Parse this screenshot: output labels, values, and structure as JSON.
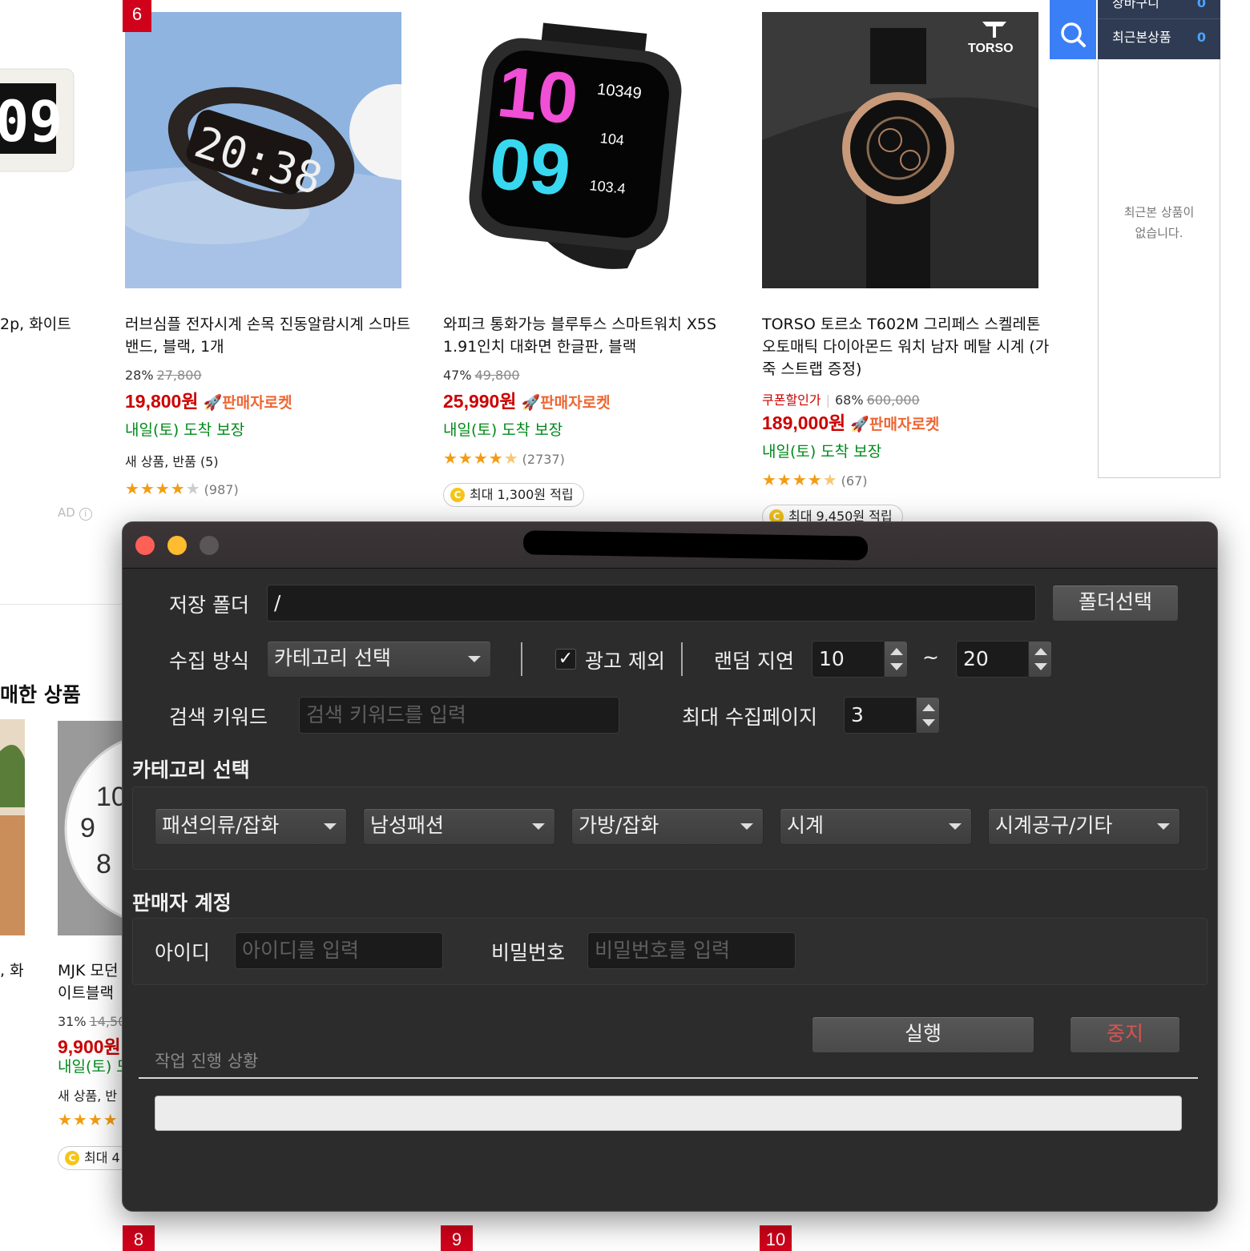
{
  "products": [
    {
      "rank": "6",
      "title": "러브심플 전자시계 손목 진동알람시계 스마트 밴드, 블랙, 1개",
      "discount": "28%",
      "original_price": "27,800",
      "price": "19,800원",
      "rocket_label": "판매자로켓",
      "delivery": "내일(토) 도착 보장",
      "extra_info": "새 상품, 반품 (5)",
      "rating": 4.0,
      "review_count": "(987)"
    },
    {
      "title": "와피크 통화가능 블루투스 스마트워치 X5S 1.91인치 대화면 한글판, 블랙",
      "discount": "47%",
      "original_price": "49,800",
      "price": "25,990원",
      "rocket_label": "판매자로켓",
      "delivery": "내일(토) 도착 보장",
      "rating": 4.5,
      "review_count": "(2737)",
      "cashback": "최대 1,300원 적립"
    },
    {
      "title": "TORSO 토르소 T602M 그리페스 스켈레톤 오토매틱 다이아몬드 워치 남자 메탈 시계 (가죽 스트랩 증정)",
      "coupon_label": "쿠폰할인가",
      "discount": "68%",
      "original_price": "600,000",
      "price": "189,000원",
      "rocket_label": "판매자로켓",
      "delivery": "내일(토) 도착 보장",
      "rating": 4.5,
      "review_count": "(67)",
      "cashback": "최대 9,450원 적립",
      "brand_logo": "TORSO"
    }
  ],
  "left_partial": {
    "title_fragment": "2p, 화이트",
    "ad_label": "AD",
    "section_title": "매한 상품",
    "second_title_fragment": ", 화"
  },
  "left_product_2": {
    "title": "MJK 모던\n이트블랙",
    "discount": "31%",
    "original_price": "14,50",
    "price": "9,900원",
    "delivery": "내일(토) 도",
    "extra_info": "새 상품, 반",
    "cashback": "최대 4"
  },
  "clock_face_numbers": [
    "10",
    "9",
    "8"
  ],
  "bottom_ranks": [
    "8",
    "9",
    "10"
  ],
  "sidebar": {
    "cart_label": "장바구니",
    "cart_count": "0",
    "recent_label": "최근본상품",
    "recent_count": "0",
    "empty_message": "최근본 상품이\n없습니다."
  },
  "icons": {
    "search": "search-icon",
    "info": "info-icon",
    "coin": "coin-icon",
    "rocket": "rocket-icon"
  },
  "dialog": {
    "title_redacted": "redacted",
    "save_folder_label": "저장 폴더",
    "save_folder_value": "/",
    "folder_select_button": "폴더선택",
    "collect_method_label": "수집 방식",
    "collect_method_value": "카테고리 선택",
    "exclude_ads_label": "광고 제외",
    "exclude_ads_checked": true,
    "random_delay_label": "랜덤 지연",
    "delay_min": "10",
    "delay_separator": "~",
    "delay_max": "20",
    "keyword_label": "검색 키워드",
    "keyword_placeholder": "검색 키워드를 입력",
    "max_pages_label": "최대 수집페이지",
    "max_pages_value": "3",
    "category_section_label": "카테고리 선택",
    "categories": [
      "패션의류/잡화",
      "남성패션",
      "가방/잡화",
      "시계",
      "시계공구/기타"
    ],
    "seller_section_label": "판매자 계정",
    "id_label": "아이디",
    "id_placeholder": "아이디를 입력",
    "password_label": "비밀번호",
    "password_placeholder": "비밀번호를 입력",
    "run_button": "실행",
    "stop_button": "중지",
    "progress_label": "작업 진행 상황",
    "progress": 0
  },
  "colors": {
    "price_red": "#cc0000",
    "delivery_green": "#00891a",
    "star_orange": "#f39c12",
    "search_blue": "#3a7ff6",
    "sidebar_navy": "#2f3b52",
    "dialog_bg": "#2c2c2c",
    "stop_red": "#d9534f"
  }
}
